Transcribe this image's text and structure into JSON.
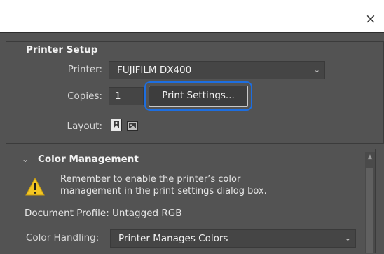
{
  "window": {
    "close_glyph": "×"
  },
  "printer_setup": {
    "title": "Printer Setup",
    "printer_label": "Printer:",
    "printer_value": "FUJIFILM DX400",
    "copies_label": "Copies:",
    "copies_value": "1",
    "print_settings_label": "Print Settings...",
    "layout_label": "Layout:",
    "layout_options": [
      "portrait-icon",
      "landscape-icon"
    ]
  },
  "color_management": {
    "title": "Color Management",
    "warning_line1": "Remember to enable the printer’s color",
    "warning_line2": "management in the print settings dialog box.",
    "document_profile": "Document Profile: Untagged RGB",
    "color_handling_label": "Color Handling:",
    "color_handling_value": "Printer Manages Colors"
  },
  "colors": {
    "panel_bg": "#535353",
    "field_bg": "#454545",
    "highlight_border": "#1d6ee0",
    "warning_yellow": "#f3c623"
  }
}
